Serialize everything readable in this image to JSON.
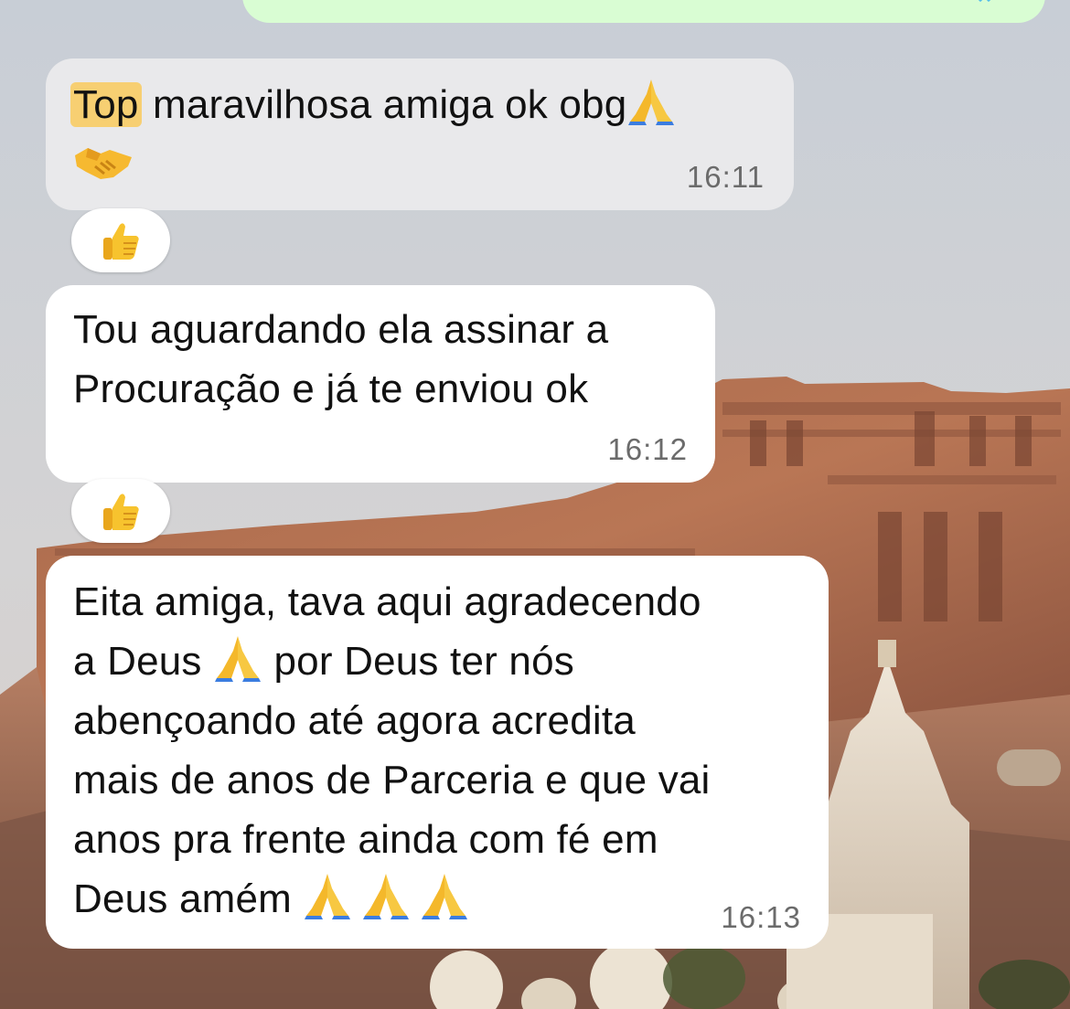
{
  "messages": [
    {
      "id": "msg1",
      "line1_highlight": "Top",
      "line1_rest": " maravilhosa amiga ok obg",
      "time": "16:11",
      "reaction": "thumbs-up"
    },
    {
      "id": "msg2",
      "lines": [
        "Tou aguardando ela assinar a",
        "Procuração e já te enviou ok"
      ],
      "time": "16:12",
      "reaction": "thumbs-up"
    },
    {
      "id": "msg3",
      "line1": "Eita amiga, tava aqui agradecendo",
      "line2_before": "a Deus ",
      "line2_after": " por Deus ter nós",
      "line3": "abençoando até agora acredita",
      "line4": "mais de anos de Parceria e que vai",
      "line5": "anos pra frente ainda com fé em",
      "line6": "Deus amém ",
      "time": "16:13"
    }
  ],
  "icons": {
    "pray": "folded-hands-icon",
    "handshake": "handshake-icon",
    "thumbs_up": "thumbs-up-icon",
    "read_receipt": "double-check-icon"
  },
  "colors": {
    "incoming_bubble": "#ffffff",
    "highlighted_bubble": "#e9e9eb",
    "outgoing_bubble": "#d9fdd3",
    "search_highlight": "#f7cf72",
    "timestamp": "#6b6b6b"
  }
}
